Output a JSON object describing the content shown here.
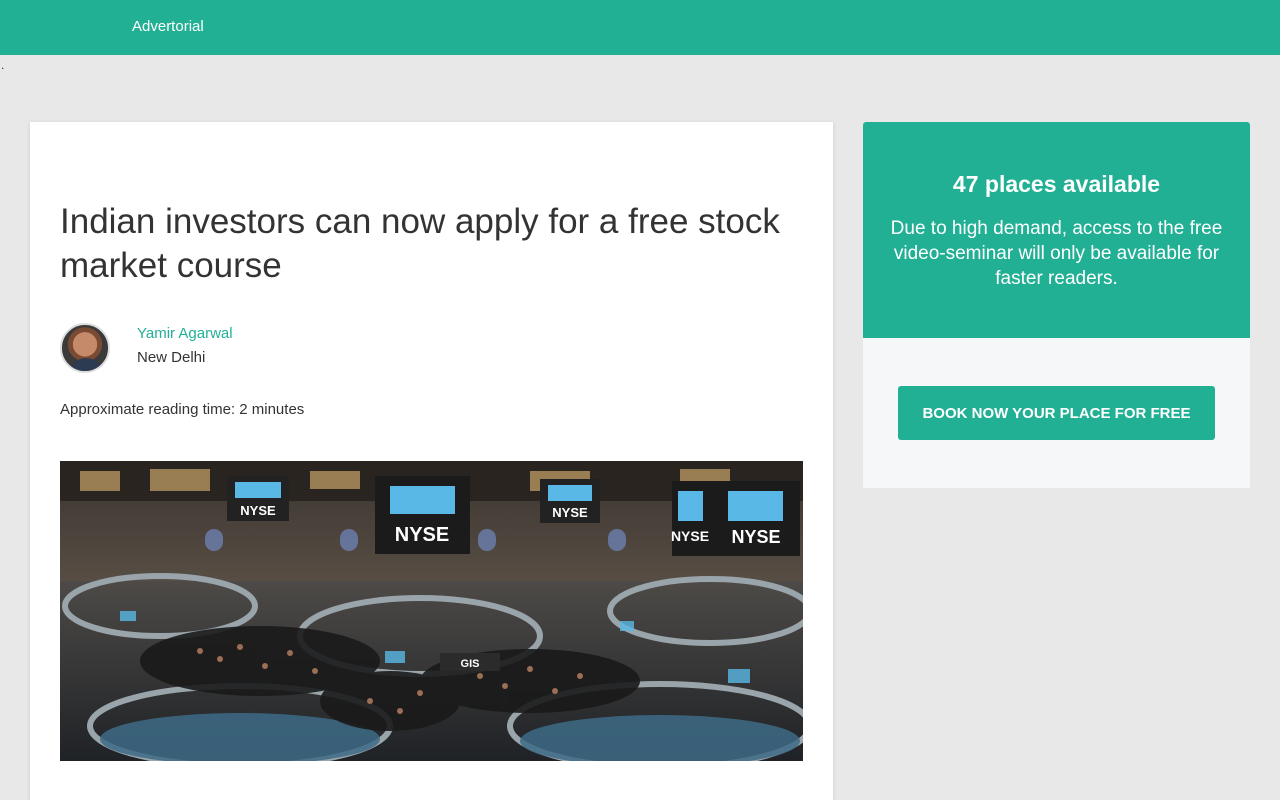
{
  "header": {
    "label": "Advertorial"
  },
  "stray_mark": ".",
  "article": {
    "headline": "Indian investors can now apply for a free stock market course",
    "author": {
      "name": "Yamir Agarwal",
      "city": "New Delhi"
    },
    "reading_time": "Approximate reading time: 2 minutes",
    "hero_signs": [
      "NYSE",
      "NYSE",
      "NYSE",
      "NYSE",
      "NYSE",
      "GIS"
    ]
  },
  "sidebar": {
    "places": "47 places available",
    "note": "Due to high demand, access to the free video-seminar will only be available for faster readers.",
    "cta_label": "BOOK NOW YOUR PLACE FOR FREE"
  },
  "colors": {
    "accent": "#22b095",
    "page_bg": "#e8e8e8",
    "panel_bg": "#f5f7f8"
  }
}
